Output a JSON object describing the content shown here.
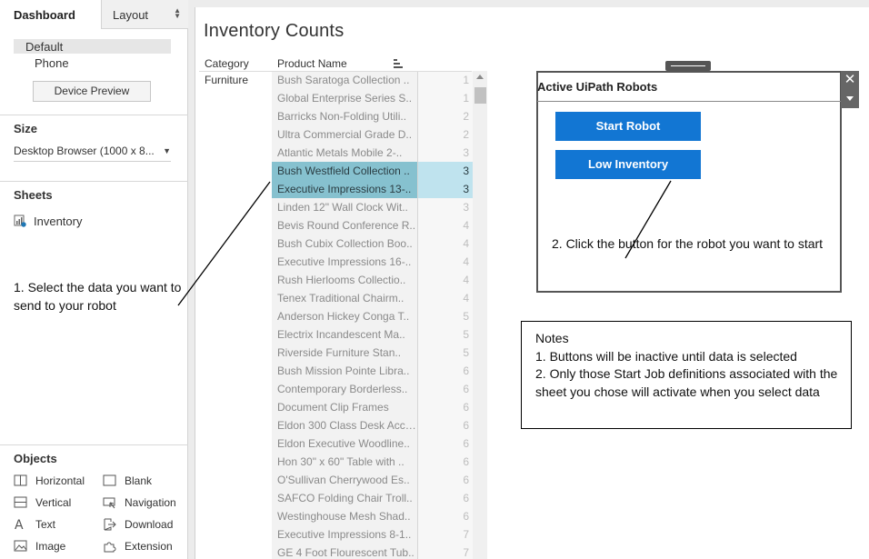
{
  "sidebar": {
    "tabs": {
      "dashboard": "Dashboard",
      "layout": "Layout"
    },
    "devices": {
      "default": "Default",
      "phone": "Phone",
      "preview_button": "Device Preview"
    },
    "size": {
      "heading": "Size",
      "value": "Desktop Browser (1000 x 8..."
    },
    "sheets": {
      "heading": "Sheets",
      "items": [
        {
          "label": "Inventory"
        }
      ]
    },
    "instruction": "1.  Select the data you want to send to your robot",
    "objects": {
      "heading": "Objects",
      "items": [
        {
          "label": "Horizontal",
          "icon": "horizontal-container-icon"
        },
        {
          "label": "Blank",
          "icon": "blank-icon"
        },
        {
          "label": "Vertical",
          "icon": "vertical-container-icon"
        },
        {
          "label": "Navigation",
          "icon": "navigation-icon"
        },
        {
          "label": "Text",
          "icon": "text-icon"
        },
        {
          "label": "Download",
          "icon": "download-icon"
        },
        {
          "label": "Image",
          "icon": "image-icon"
        },
        {
          "label": "Extension",
          "icon": "extension-icon"
        }
      ]
    }
  },
  "worksheet": {
    "title": "Inventory Counts",
    "columns": {
      "category": "Category",
      "product": "Product Name"
    },
    "category_value": "Furniture",
    "rows": [
      {
        "name": "Bush Saratoga Collection ..",
        "count": "1",
        "selected": false
      },
      {
        "name": "Global Enterprise Series S..",
        "count": "1",
        "selected": false
      },
      {
        "name": "Barricks Non-Folding Utili..",
        "count": "2",
        "selected": false
      },
      {
        "name": "Ultra Commercial Grade D..",
        "count": "2",
        "selected": false
      },
      {
        "name": "Atlantic Metals Mobile 2-..",
        "count": "3",
        "selected": false
      },
      {
        "name": "Bush Westfield Collection ..",
        "count": "3",
        "selected": true
      },
      {
        "name": "Executive Impressions 13-..",
        "count": "3",
        "selected": true
      },
      {
        "name": "Linden 12\" Wall Clock Wit..",
        "count": "3",
        "selected": false
      },
      {
        "name": "Bevis Round Conference R..",
        "count": "4",
        "selected": false
      },
      {
        "name": "Bush Cubix Collection Boo..",
        "count": "4",
        "selected": false
      },
      {
        "name": "Executive Impressions 16-..",
        "count": "4",
        "selected": false
      },
      {
        "name": "Rush Hierlooms Collectio..",
        "count": "4",
        "selected": false
      },
      {
        "name": "Tenex Traditional Chairm..",
        "count": "4",
        "selected": false
      },
      {
        "name": "Anderson Hickey Conga T..",
        "count": "5",
        "selected": false
      },
      {
        "name": "Electrix Incandescent Ma..",
        "count": "5",
        "selected": false
      },
      {
        "name": "Riverside Furniture Stan..",
        "count": "5",
        "selected": false
      },
      {
        "name": "Bush Mission Pointe Libra..",
        "count": "6",
        "selected": false
      },
      {
        "name": "Contemporary Borderless..",
        "count": "6",
        "selected": false
      },
      {
        "name": "Document Clip Frames",
        "count": "6",
        "selected": false
      },
      {
        "name": "Eldon 300 Class Desk Acce..",
        "count": "6",
        "selected": false
      },
      {
        "name": "Eldon Executive Woodline..",
        "count": "6",
        "selected": false
      },
      {
        "name": "Hon 30\" x 60\" Table with ..",
        "count": "6",
        "selected": false
      },
      {
        "name": "O'Sullivan Cherrywood Es..",
        "count": "6",
        "selected": false
      },
      {
        "name": "SAFCO Folding Chair Troll..",
        "count": "6",
        "selected": false
      },
      {
        "name": "Westinghouse Mesh Shad..",
        "count": "6",
        "selected": false
      },
      {
        "name": "Executive Impressions 8-1..",
        "count": "7",
        "selected": false
      },
      {
        "name": "GE 4 Foot Flourescent Tub..",
        "count": "7",
        "selected": false
      }
    ]
  },
  "extension": {
    "title": "Active UiPath Robots",
    "buttons": {
      "start": "Start Robot",
      "low": "Low Inventory"
    },
    "close_glyph": "✕",
    "instruction": "2.  Click the button for the robot you want to start"
  },
  "notes": {
    "heading": "Notes",
    "lines": [
      "1. Buttons will be inactive until data is selected",
      "2. Only those Start Job definitions associated with the sheet you chose will activate when you select data"
    ]
  },
  "colors": {
    "button": "#1276d3",
    "selection": "#86c1cf",
    "selection_light": "#bfe3ee"
  }
}
